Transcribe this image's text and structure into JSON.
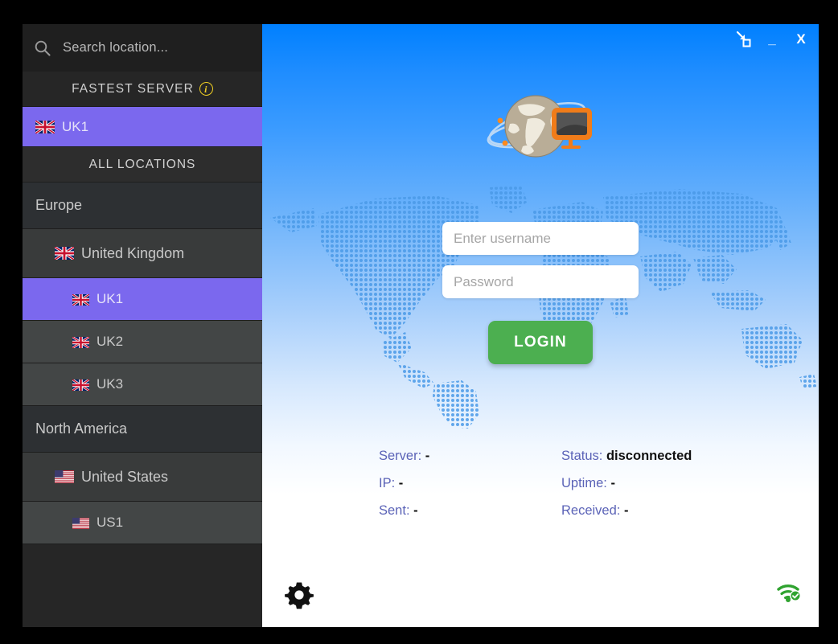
{
  "window": {
    "controls": [
      {
        "name": "minimize-to-tray",
        "label": "",
        "icon": "tray-arrow-icon"
      },
      {
        "name": "minimize",
        "label": "_",
        "icon": "minimize-icon"
      },
      {
        "name": "close",
        "label": "X",
        "icon": "close-icon"
      }
    ]
  },
  "sidebar": {
    "search": {
      "placeholder": "Search location...",
      "value": "",
      "icon": "search-icon"
    },
    "fastest_section": {
      "title": "FASTEST SERVER",
      "info_icon_label": "i",
      "item": {
        "label": "UK1",
        "flag": "gb",
        "selected": true
      }
    },
    "all_locations_title": "ALL LOCATIONS",
    "groups": [
      {
        "region": "Europe",
        "countries": [
          {
            "label": "United Kingdom",
            "flag": "gb",
            "servers": [
              {
                "label": "UK1",
                "flag": "gb",
                "selected": true
              },
              {
                "label": "UK2",
                "flag": "gb",
                "selected": false
              },
              {
                "label": "UK3",
                "flag": "gb",
                "selected": false
              }
            ]
          }
        ]
      },
      {
        "region": "North America",
        "countries": [
          {
            "label": "United States",
            "flag": "us",
            "servers": [
              {
                "label": "US1",
                "flag": "us",
                "selected": false
              }
            ]
          }
        ]
      }
    ]
  },
  "main": {
    "logo_alt": "globe-tv-logo",
    "login": {
      "username_placeholder": "Enter username",
      "username_value": "",
      "password_placeholder": "Password",
      "password_value": "",
      "button_label": "LOGIN"
    },
    "status": {
      "server_label": "Server:",
      "server_value": "-",
      "status_label": "Status:",
      "status_value": "disconnected",
      "ip_label": "IP:",
      "ip_value": "-",
      "uptime_label": "Uptime:",
      "uptime_value": "-",
      "sent_label": "Sent:",
      "sent_value": "-",
      "received_label": "Received:",
      "received_value": "-"
    },
    "footer": {
      "settings_icon": "gear-icon",
      "connection_icon": "wifi-check-icon"
    }
  },
  "colors": {
    "accent_purple": "#7b68ee",
    "login_green": "#4caf50",
    "header_blue": "#0080ff",
    "label_blue": "#5b63b7",
    "info_yellow": "#f2d022",
    "wifi_green": "#3aa93a"
  }
}
